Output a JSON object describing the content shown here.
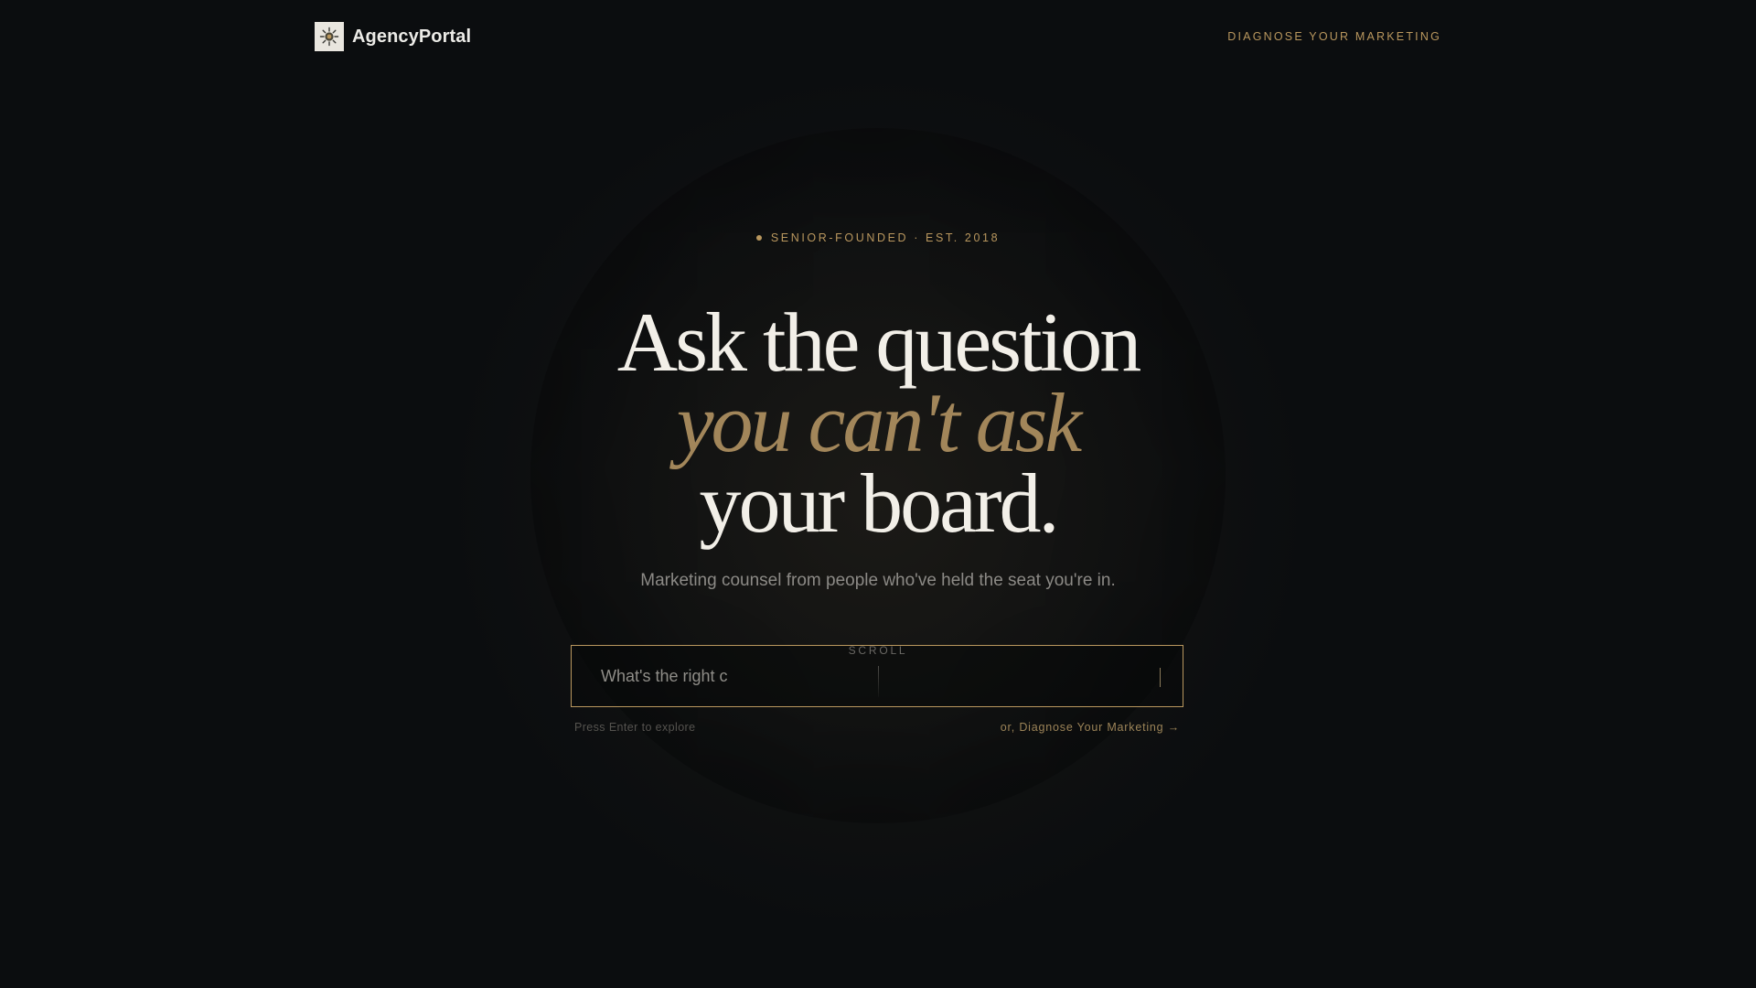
{
  "header": {
    "brand_name": "AgencyPortal",
    "cta_label": "DIAGNOSE YOUR MARKETING",
    "logo_icon": "sunburst-logo-icon"
  },
  "hero": {
    "eyebrow": "SENIOR-FOUNDED · EST. 2018",
    "headline_line1": "Ask the question",
    "headline_line2": "you can't ask",
    "headline_line3": "your board.",
    "subheadline": "Marketing counsel from people who've held the seat you're in.",
    "scroll_label": "SCROLL"
  },
  "ask": {
    "value": "What's the right c",
    "hint": "Press Enter to explore",
    "alt_link": "or, Diagnose Your Marketing →"
  },
  "colors": {
    "background": "#0b0d0f",
    "accent_gold": "#b9975e",
    "headline_white": "#f2efe8",
    "headline_italic": "#a2865a"
  }
}
